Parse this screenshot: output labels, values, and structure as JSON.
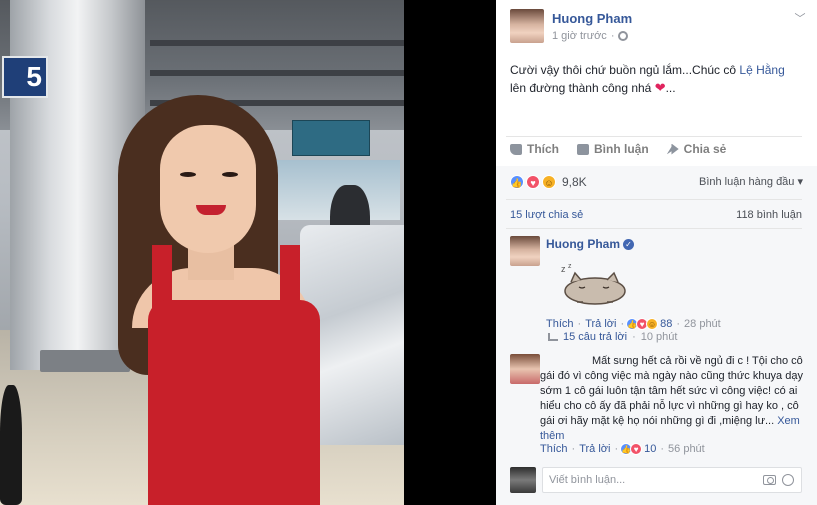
{
  "photo": {
    "gate_number": "5",
    "alt": ""
  },
  "post": {
    "author": "Huong Pham",
    "time": "1 giờ trước",
    "text_before_mention": "Cười vậy thôi chứ buồn ngủ lắm...Chúc cô ",
    "mention": "Lệ Hằng",
    "text_after_mention": " lên đường thành công nhá ",
    "text_end": "...",
    "heart": "❤",
    "audience_icon": "globe-icon",
    "menu_icon": "chevron-down-icon"
  },
  "actions": {
    "like": "Thích",
    "comment": "Bình luận",
    "share": "Chia sẻ"
  },
  "feedback": {
    "reaction_count": "9,8K",
    "sort_label": "Bình luận hàng đầu ▾",
    "shares": "15 lượt chia sẻ",
    "comments": "118 bình luận"
  },
  "comments": [
    {
      "author": "Huong Pham",
      "verified": true,
      "sticker": "sleeping-cat-sticker",
      "like_label": "Thích",
      "reply_label": "Trả lời",
      "reaction_count": "88",
      "time": "28 phút",
      "replies_label": "15 câu trả lời",
      "replies_time": "10 phút"
    },
    {
      "author": "",
      "text": "Mất sưng hết cả rồi về ngủ đi c ! Tội cho cô gái đó vì công việc mà ngày nào cũng thức khuya dạy sớm 1 cô gái luôn tận tâm hết sức vì công việc! có ai hiểu cho cô ấy đã phải nỗ lực vì những gì hay ko , cô gái ơi hãy mặt kệ họ nói những gì đi ,miệng lư...",
      "see_more": "Xem thêm",
      "like_label": "Thích",
      "reply_label": "Trả lời",
      "reaction_count": "10",
      "time": "56 phút"
    }
  ],
  "composer": {
    "placeholder": "Viết bình luận..."
  },
  "colors": {
    "link": "#365899",
    "meta": "#90949c",
    "feedback_bg": "#f6f7f9",
    "dress": "#c8202a"
  }
}
